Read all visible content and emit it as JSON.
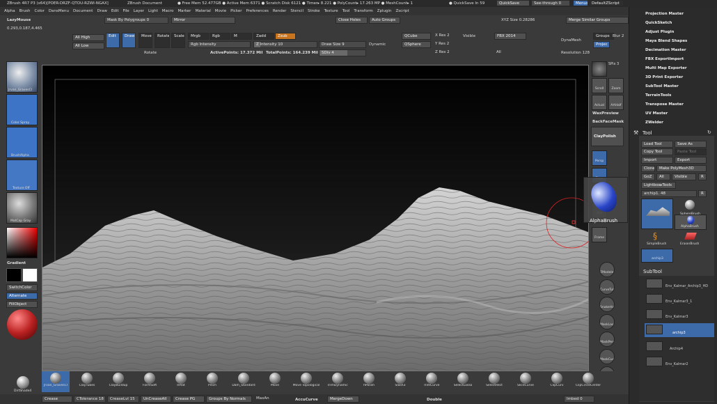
{
  "titlebar": {
    "app": "ZBrush 4R7 P3 (x64)[POER-DRZF-QTOU-RZWI-NGAX]",
    "document": "ZBrush Document",
    "stats": "● Free Mem 52.477GB ● Active Mem 6371 ● Scratch Disk 6121 ● Timer▸ 8.221 ● PolyCount▸ 17.263 MP ● MeshCount▸ 1",
    "quicksave_timer": "● QuickSave In 59",
    "quicksave": "QuickSave",
    "seethrough": "See-through",
    "seethrough_val": "0",
    "menus": "Menus",
    "defaultzscript": "DefaultZScript"
  },
  "menu": [
    "Alpha",
    "Brush",
    "Color",
    "DansMenu",
    "Document",
    "Draw",
    "Edit",
    "File",
    "Layer",
    "Light",
    "Macro",
    "Marker",
    "Material",
    "Movie",
    "Picker",
    "Preferences",
    "Render",
    "Stencil",
    "Stroke",
    "Texture",
    "Tool",
    "Transform",
    "Zplugin",
    "Zscript"
  ],
  "topshelf": {
    "lazymouse": "LazyMouse",
    "coords": "0.293,0.187,4.465",
    "mask_by_polygroups": "Mask By Polygroups",
    "mask_val": "0",
    "mirror": "Mirror",
    "close_holes": "Close Holes",
    "auto_groups": "Auto Groups",
    "merge_similar": "Merge Similar Groups",
    "xyz_size_label": "XYZ Size",
    "xyz_size_val": "0.28286",
    "all_high": "All High",
    "all_low": "All Low",
    "edit": "Edit",
    "draw": "Draw",
    "move": "Move",
    "rotate": "Rotate",
    "scale": "Scale",
    "mrgb": "Mrgb",
    "rgb": "Rgb",
    "m": "M",
    "zadd": "Zadd",
    "zsub": "Zsub",
    "rgb_intensity": "Rgb Intensity",
    "z_intensity_label": "Z Intensity",
    "z_intensity_val": "10",
    "draw_size_label": "Draw Size",
    "draw_size_val": "9",
    "dynamic": "Dynamic",
    "qcube": "QCube",
    "qsphere": "QSphere",
    "x_res_label": "X Res",
    "x_res_val": "2",
    "y_res_label": "Y Res",
    "y_res_val": "2",
    "z_res_label": "Z Res",
    "z_res_val": "2",
    "visible": "Visible",
    "fbx": "FBX 2014",
    "all": "All",
    "dynamesh": "DynaMesh",
    "groups": "Groups",
    "blur_label": "Blur",
    "blur_val": "2",
    "project": "Projec",
    "resolution_label": "Resolution",
    "resolution_val": "128",
    "rotate_label": "Rotate",
    "active_points": "ActivePoints: 17.372 Mil",
    "total_points": "TotalPoints: 164.239 Mil",
    "sdiv_label": "SDiv",
    "sdiv_val": "4"
  },
  "leftshelf": {
    "brush1": "Jrvan_GravesCl",
    "brush2": "Color Spray",
    "brush3": "BrushAlpha",
    "texture": "Texture Off",
    "material": "MatCap Gray",
    "gradient": "Gradient",
    "switchcolor": "SwitchColor",
    "alternate": "Alternate",
    "fillobject": "FillObject",
    "dirshade": "DirtShade4"
  },
  "rightshelf": {
    "spix_label": "SPix",
    "spix_val": "3",
    "scroll": "Scroll",
    "zoom": "Zoom",
    "actual": "Actual",
    "aahalf": "AAHalf",
    "waxpreview": "WaxPreview",
    "backfacemask": "BackFaceMask",
    "claypolish": "ClayPolish",
    "persp": "Persp",
    "floor": "Floor",
    "local": "Local",
    "xyz": "Xyz",
    "frame": "Frame",
    "zmodeler": "ZModeler",
    "curvetube": "CurveTube",
    "snakehook": "SnakeHook",
    "masklasso": "MaskLasso",
    "maskpen": "MaskPen",
    "maskcurve": "MaskCurve",
    "maskrect": "MaskRect",
    "tooltip": "AlphaBrush"
  },
  "rightpanel": {
    "plugins": [
      "Projection Master",
      "QuickSketch",
      "Adjust Plugin",
      "Maya Blend Shapes",
      "Decimation Master",
      "FBX ExportImport",
      "Multi Map Exporter",
      "3D Print Exporter",
      "SubTool Master",
      "TerrainTools",
      "Transpose Master",
      "UV Master",
      "ZWelder"
    ],
    "tool_title": "Tool",
    "load_tool": "Load Tool",
    "save_as": "Save As",
    "copy_tool": "Copy Tool",
    "paste_tool": "Paste Tool",
    "import": "Import",
    "export": "Export",
    "clone": "Clone",
    "make_polymesh": "Make PolyMesh3D",
    "goz": "GoZ",
    "all": "All",
    "visible": "Visible",
    "r": "R",
    "lightbox_tools": "Lightbox▸Tools",
    "current_tool_label": "archip1.",
    "current_tool_val": "48",
    "tools": [
      "",
      "SphereBrush",
      "AlphaBrush",
      "SimpleBrush",
      "EraserBrush",
      "archip3"
    ],
    "subtool_title": "SubTool",
    "subtools": [
      "Env_Kalmar_Archip3_HD",
      "Env_Kalmar3_1",
      "Env_Kalmar3",
      "archip3",
      "Archip4",
      "Env_Kalmar2"
    ]
  },
  "bottomshelf": {
    "brushes": [
      "Jrvan_GravesCl",
      "ClayTubes",
      "ClayBuildup",
      "FormSoft",
      "Inflat",
      "Pinch",
      "Dam_Standard",
      "Move",
      "Move Topological",
      "TrimDynamic",
      "hPolish",
      "Slash3",
      "TrimCurve",
      "SelectLasso",
      "SelectRect",
      "SliceCurve",
      "ClipCurv",
      "ClipCircleCenter"
    ]
  },
  "bottombar": {
    "crease": "Crease",
    "ctolerance_label": "CTolerance",
    "ctolerance_val": "18",
    "creaselvl_label": "CreaseLvl",
    "creaselvl_val": "15",
    "uncreaseall": "UnCreaseAll",
    "crease_pg": "Crease PG",
    "groups_by_normals": "Groups By Normals",
    "maxang": "MaxAn",
    "accucurve": "AccuCurve",
    "mergedown": "MergeDown",
    "double": "Double",
    "imbed_label": "Imbed",
    "imbed_val": "0"
  },
  "colors": {
    "accent_orange": "#c8731e",
    "accent_blue": "#3d6aa8",
    "panel_bg": "#2b2b2b",
    "viewport_bg": "#000000"
  }
}
